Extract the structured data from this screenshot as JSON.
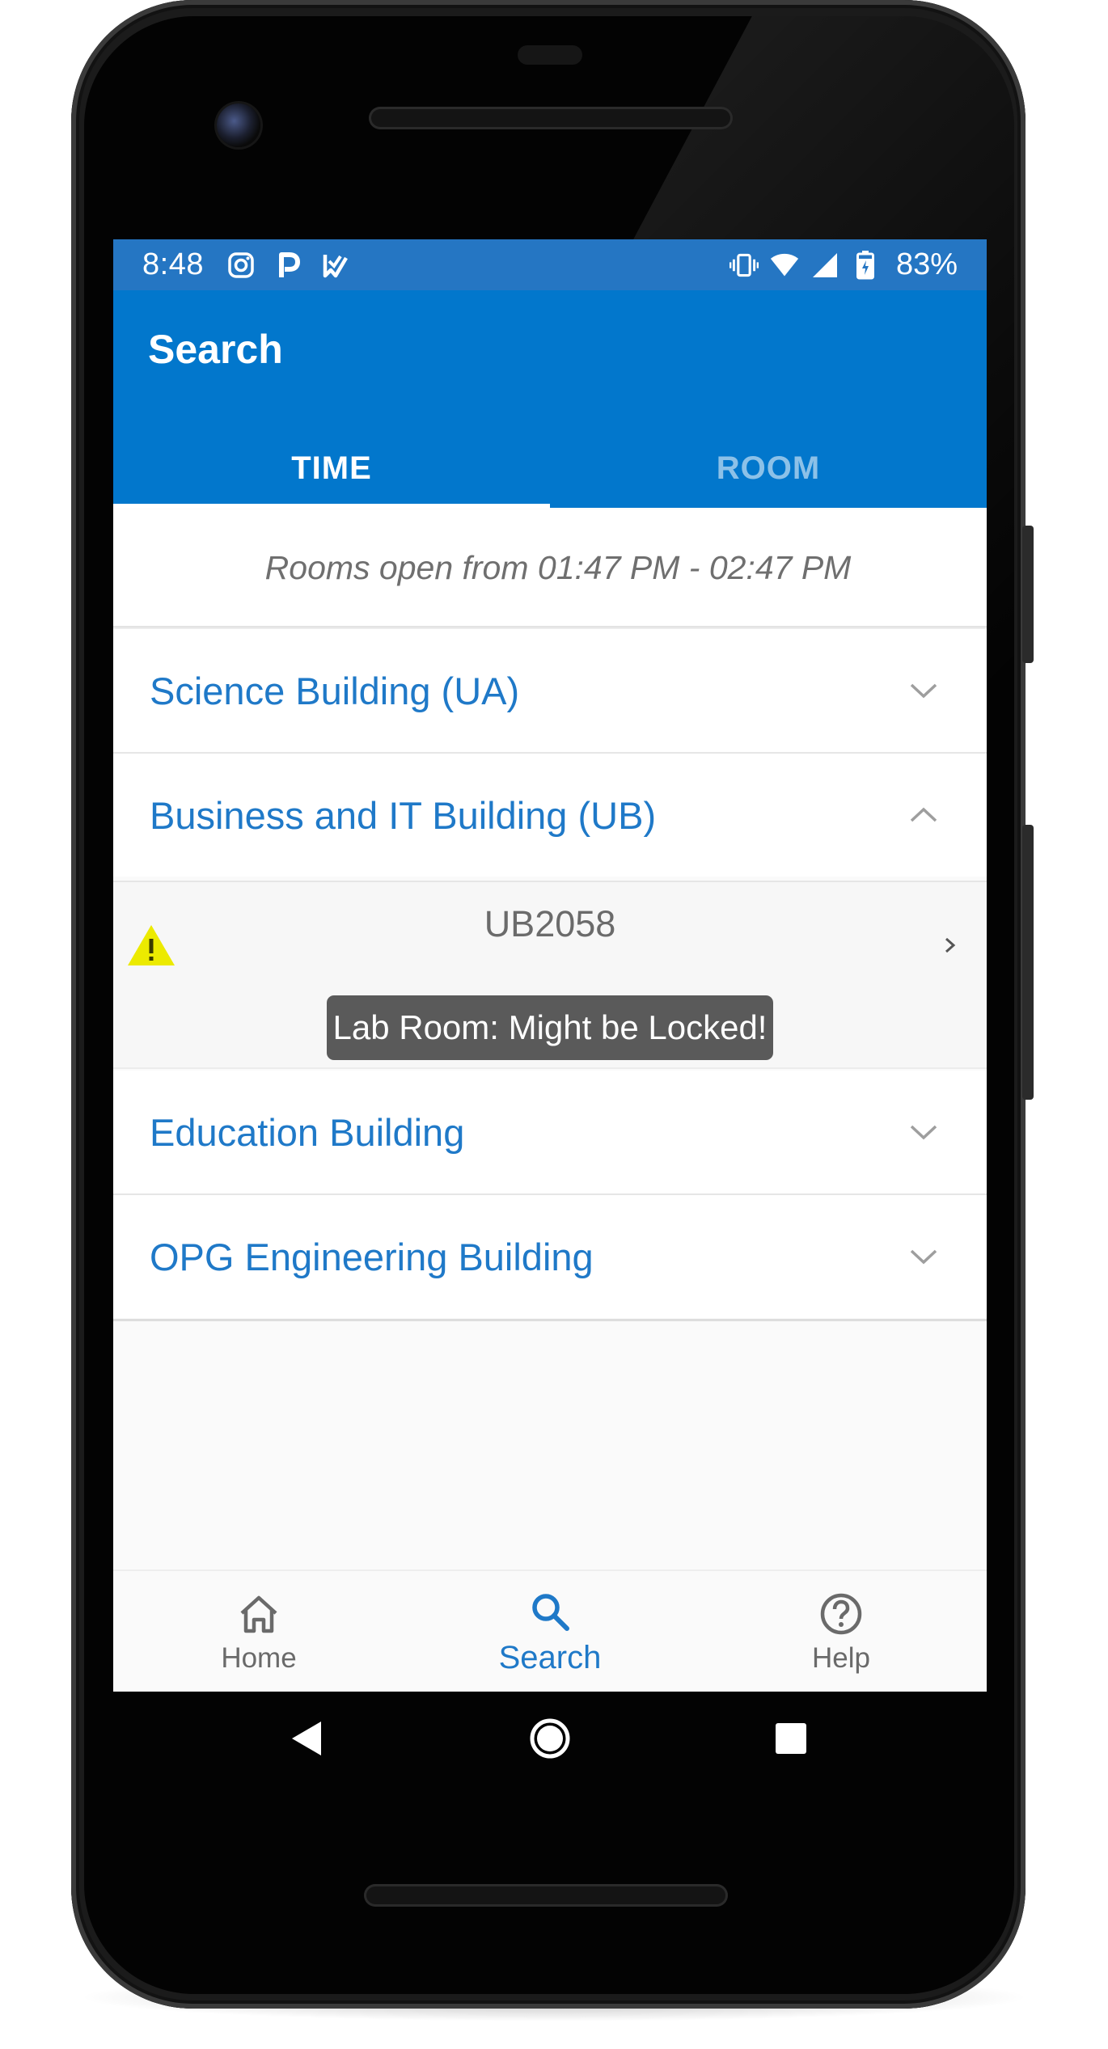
{
  "status_bar": {
    "time": "8:48",
    "left_icons": [
      "instagram-icon",
      "parking-icon",
      "task-icon"
    ],
    "right_icons": [
      "vibrate-icon",
      "wifi-icon",
      "cell-signal-icon",
      "battery-charging-icon"
    ],
    "battery": "83%"
  },
  "app_bar": {
    "title": "Search",
    "tabs": [
      {
        "label": "TIME",
        "selected": true
      },
      {
        "label": "ROOM",
        "selected": false
      }
    ]
  },
  "range_banner": "Rooms open from 01:47 PM - 02:47 PM",
  "buildings": [
    {
      "name": "Science Building (UA)",
      "expanded": false
    },
    {
      "name": "Business and IT Building (UB)",
      "expanded": true
    },
    {
      "name": "Education Building",
      "expanded": false
    },
    {
      "name": "OPG Engineering Building",
      "expanded": false
    }
  ],
  "room": {
    "name": "UB2058",
    "warning_icon": "warning-icon",
    "note": "Lab Room: Might be Locked!"
  },
  "bottom_nav": [
    {
      "label": "Home",
      "icon": "home-icon",
      "active": false
    },
    {
      "label": "Search",
      "icon": "search-icon",
      "active": true
    },
    {
      "label": "Help",
      "icon": "help-icon",
      "active": false
    }
  ],
  "colors": {
    "primary": "#0277cc",
    "status_bar": "#2576c3",
    "accent_text": "#1f79c8",
    "warning": "#ecea00",
    "tooltip_bg": "#5a5a5a"
  }
}
